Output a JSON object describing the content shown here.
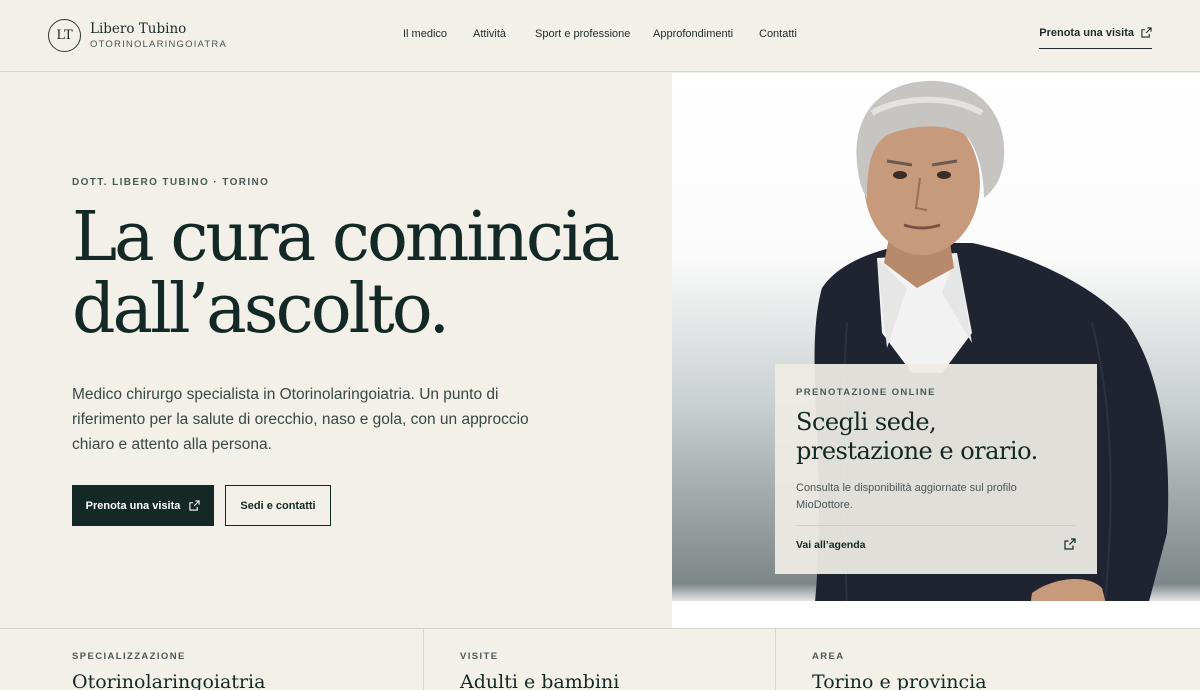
{
  "header": {
    "logo_initials": "LT",
    "logo_name": "Libero Tubino",
    "logo_subtitle": "OTORINOLARINGOIATRA",
    "nav": [
      "Il medico",
      "Attività",
      "Sport e professione",
      "Approfondimenti",
      "Contatti"
    ],
    "cta_label": "Prenota una visita"
  },
  "hero": {
    "eyebrow": "DOTT. LIBERO TUBINO · TORINO",
    "title_line1": "La cura comincia",
    "title_line2": "dall’ascolto.",
    "lead": "Medico chirurgo specialista in Otorinolaringoiatria. Un punto di riferimento per la salute di orecchio, naso e gola, con un approccio chiaro e attento alla persona.",
    "primary_button": "Prenota una visita",
    "secondary_button": "Sedi e contatti"
  },
  "booking_card": {
    "eyebrow": "PRENOTAZIONE ONLINE",
    "title_line1": "Scegli sede,",
    "title_line2": "prestazione e orario.",
    "text": "Consulta le disponibilità aggiornate sul profilo MioDottore.",
    "link": "Vai all’agenda"
  },
  "stats": [
    {
      "label": "SPECIALIZZAZIONE",
      "value": "Otorinolaringoiatria"
    },
    {
      "label": "VISITE",
      "value": "Adulti e bambini"
    },
    {
      "label": "AREA",
      "value": "Torino e provincia"
    }
  ],
  "colors": {
    "background": "#f3f0e9",
    "primary": "#142826",
    "card": "#eeebe4"
  },
  "icons": {
    "external_link": "external-link-icon"
  }
}
